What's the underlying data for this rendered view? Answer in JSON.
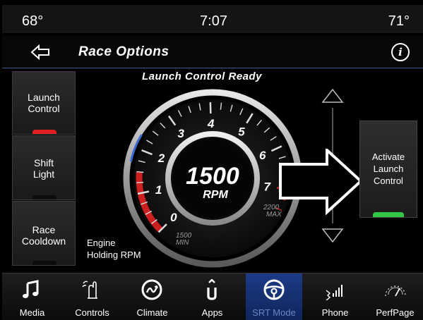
{
  "status": {
    "temp_left": "68°",
    "time": "7:07",
    "temp_right": "71°"
  },
  "header": {
    "title": "Race Options",
    "back_icon": "back-arrow-icon",
    "info_icon": "info-icon"
  },
  "launch_status": "Launch Control Ready",
  "left_buttons": [
    {
      "label_line1": "Launch",
      "label_line2": "Control",
      "indicator_color": "#e02020"
    },
    {
      "label_line1": "Shift",
      "label_line2": "Light",
      "indicator_color": "#111111"
    },
    {
      "label_line1": "Race",
      "label_line2": "Cooldown",
      "indicator_color": "#111111"
    }
  ],
  "engine_label_line1": "Engine",
  "engine_label_line2": "Holding RPM",
  "gauge": {
    "value": "1500",
    "unit": "RPM",
    "tick_labels": [
      "0",
      "1",
      "2",
      "3",
      "4",
      "5",
      "6",
      "7"
    ],
    "min_label_value": "1500",
    "min_label_text": "MIN",
    "max_label_value": "2200",
    "max_label_text": "MAX",
    "needle_rpm_thousands": 1.5
  },
  "activate_button": {
    "line1": "Activate",
    "line2": "Launch",
    "line3": "Control",
    "indicator_color": "#33c748"
  },
  "nav": [
    {
      "label": "Media",
      "icon": "music-note-icon"
    },
    {
      "label": "Controls",
      "icon": "hand-touch-icon"
    },
    {
      "label": "Climate",
      "icon": "climate-icon"
    },
    {
      "label": "Apps",
      "icon": "apps-icon"
    },
    {
      "label": "SRT Mode",
      "icon": "steering-wheel-icon",
      "active": true
    },
    {
      "label": "Phone",
      "icon": "phone-signal-icon"
    },
    {
      "label": "PerfPage",
      "icon": "performance-gauge-icon"
    }
  ],
  "colors": {
    "accent_blue": "#1c3a86",
    "redline": "#cc1f1f",
    "ready_green": "#33c748"
  }
}
